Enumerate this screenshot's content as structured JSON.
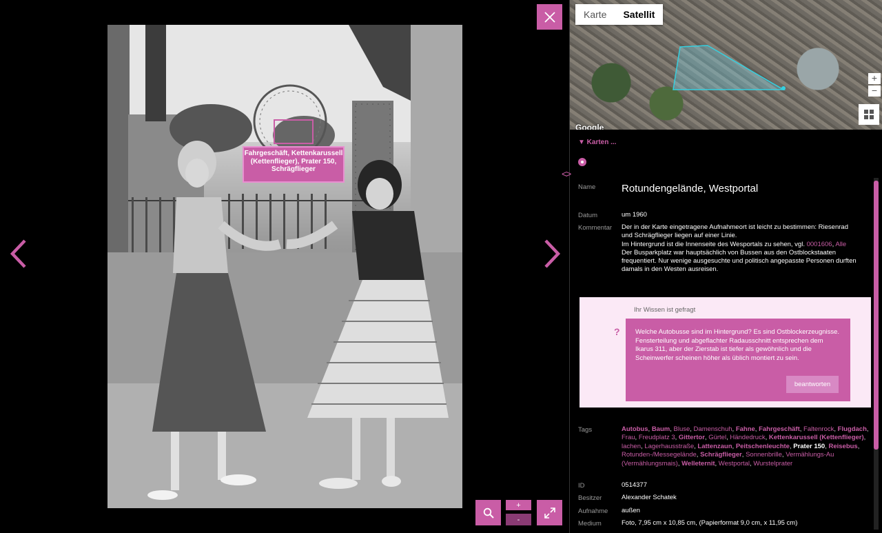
{
  "photo_annotation": "Fahrgeschäft, Kettenkarussell (Kettenflieger), Prater 150, Schrägflieger",
  "map": {
    "tabs": [
      "Karte",
      "Satellit"
    ],
    "active_tab": "Satellit",
    "zoom_in": "+",
    "zoom_out": "−",
    "attribution": "Google"
  },
  "toggle_maps": "▼ Karten ...",
  "collapse_icon": "<>",
  "fields": {
    "name_label": "Name",
    "name_value": "Rotundengelände, Westportal",
    "datum_label": "Datum",
    "datum_value": "um 1960",
    "kommentar_label": "Kommentar",
    "kommentar_line1": "Der in der Karte eingetragene Aufnahmeort ist leicht zu bestimmen: Riesenrad und Schrägflieger liegen auf einer Linie.",
    "kommentar_line2": "Im Hintergrund ist die Innenseite des Wesportals zu sehen, vgl.",
    "kommentar_link1": "0001606",
    "kommentar_link2": "Alle",
    "kommentar_line3": "Der Busparkplatz war hauptsächlich von Bussen aus den Ostblockstaaten frequentiert. Nur wenige ausgesuchte und politisch angepasste Personen durften damals in den Westen ausreisen.",
    "tags_label": "Tags",
    "id_label": "ID",
    "id_value": "0514377",
    "besitzer_label": "Besitzer",
    "besitzer_value": "Alexander Schatek",
    "aufnahme_label": "Aufnahme",
    "aufnahme_value": "außen",
    "medium_label": "Medium",
    "medium_value": "Foto, 7,95 cm x 10,85 cm, (Papierformat 9,0 cm, x 11,95 cm)"
  },
  "wissen": {
    "heading": "Ihr Wissen ist gefragt",
    "question_mark": "?",
    "text": "Welche Autobusse sind im Hintergrund? Es sind Ostblockerzeugnisse. Fensterteilung und abgeflachter Radausschnitt entsprechen dem Ikarus 311, aber der Zierstab ist tiefer als gewöhnlich und die Scheinwerfer scheinen höher als üblich montiert zu sein.",
    "button": "beantworten"
  },
  "tags": [
    {
      "t": "Autobus",
      "s": "b"
    },
    {
      "t": "Baum",
      "s": "b"
    },
    {
      "t": "Bluse",
      "s": ""
    },
    {
      "t": "Damenschuh",
      "s": ""
    },
    {
      "t": "Fahne",
      "s": "b"
    },
    {
      "t": "Fahrgeschäft",
      "s": "b"
    },
    {
      "t": "Faltenrock",
      "s": ""
    },
    {
      "t": "Flugdach",
      "s": "b"
    },
    {
      "t": "Frau",
      "s": ""
    },
    {
      "t": "Freudplatz 3",
      "s": ""
    },
    {
      "t": "Gittertor",
      "s": "b"
    },
    {
      "t": "Gürtel",
      "s": ""
    },
    {
      "t": "Händedruck",
      "s": ""
    },
    {
      "t": "Kettenkarussell (Kettenflieger)",
      "s": "b"
    },
    {
      "t": "lachen",
      "s": ""
    },
    {
      "t": "Lagerhausstraße",
      "s": ""
    },
    {
      "t": "Lattenzaun",
      "s": "b"
    },
    {
      "t": "Peitschenleuchte",
      "s": "b"
    },
    {
      "t": "Prater 150",
      "s": "w"
    },
    {
      "t": "Reisebus",
      "s": "b"
    },
    {
      "t": "Rotunden-/Messegelände",
      "s": ""
    },
    {
      "t": "Schrägflieger",
      "s": "b"
    },
    {
      "t": "Sonnenbrille",
      "s": ""
    },
    {
      "t": "Vermählungs-Au (Vermählungsmais)",
      "s": ""
    },
    {
      "t": "Welleternit",
      "s": "b"
    },
    {
      "t": "Westportal",
      "s": ""
    },
    {
      "t": "Wurstelprater",
      "s": ""
    }
  ],
  "toolbar": {
    "plus": "+",
    "minus": "-"
  },
  "colors": {
    "accent": "#c95da6",
    "wissen_bg": "#fbe9f6"
  }
}
